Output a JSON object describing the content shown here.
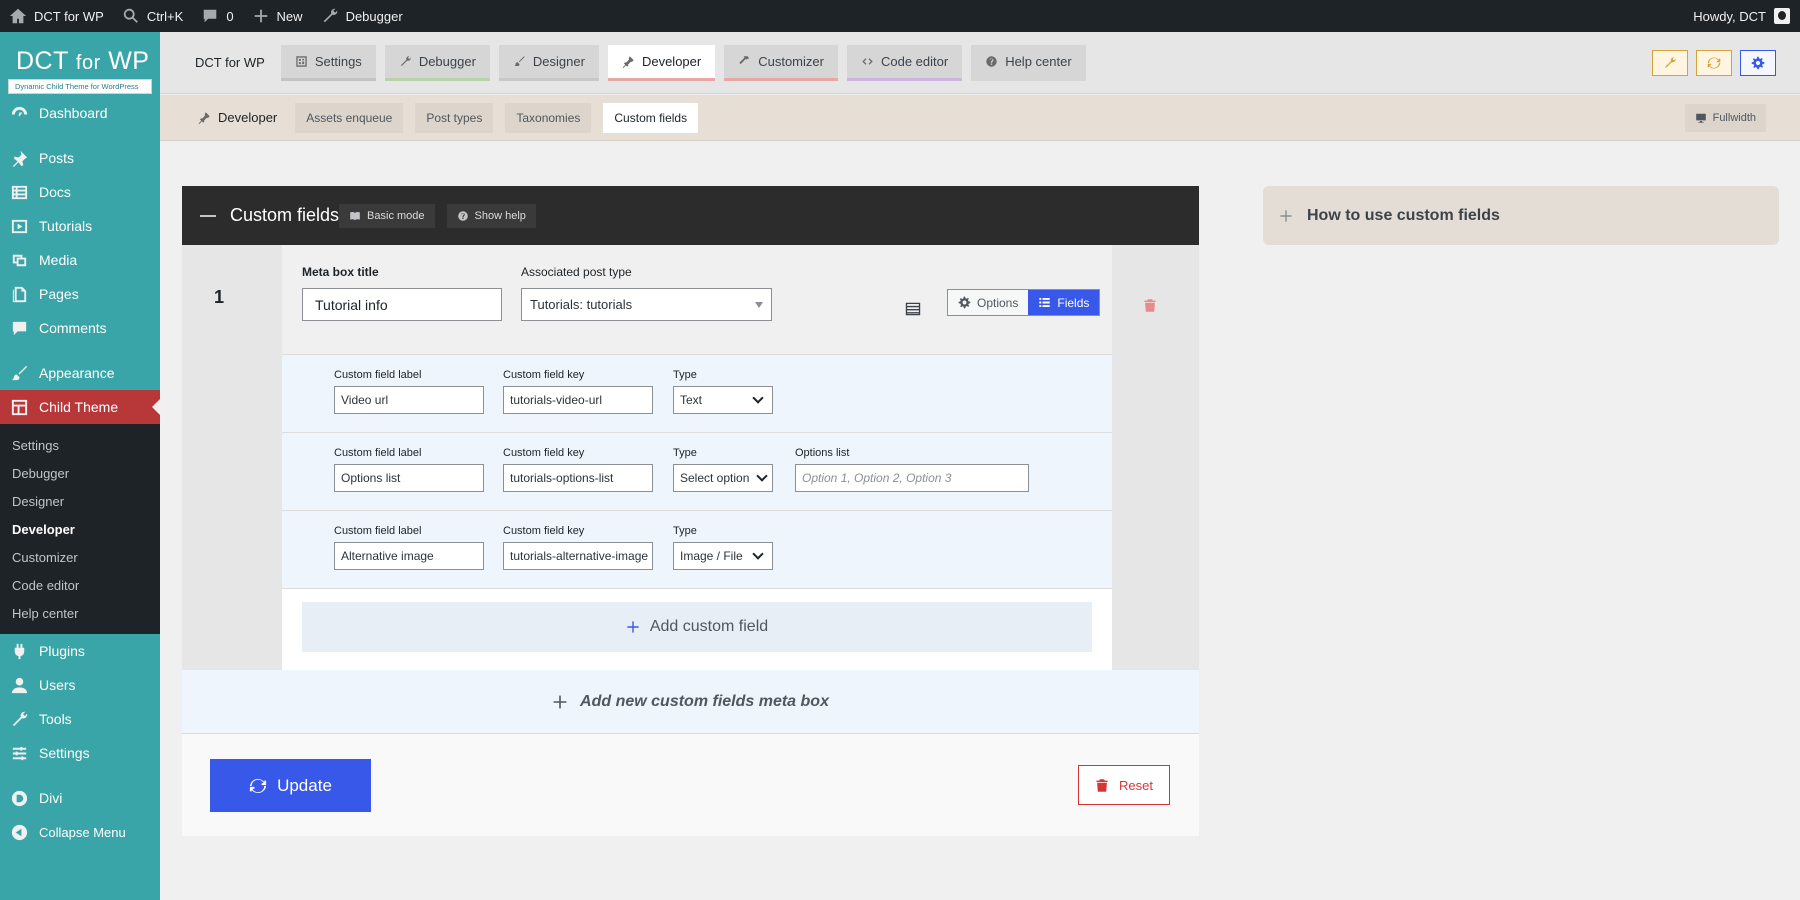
{
  "adminbar": {
    "site": "DCT for WP",
    "search": "Ctrl+K",
    "comments": "0",
    "new": "New",
    "debugger": "Debugger",
    "howdy": "Howdy, DCT"
  },
  "brand": {
    "logo_main": "DCT",
    "logo_small": "for",
    "logo_tail": "WP",
    "subtitle": "Dynamic Child Theme for WordPress"
  },
  "sidebar": {
    "items": [
      {
        "label": "Dashboard",
        "icon": "dashboard-icon"
      },
      {
        "label": "Posts",
        "icon": "pin-icon"
      },
      {
        "label": "Docs",
        "icon": "list-icon"
      },
      {
        "label": "Tutorials",
        "icon": "video-icon"
      },
      {
        "label": "Media",
        "icon": "media-icon"
      },
      {
        "label": "Pages",
        "icon": "pages-icon"
      },
      {
        "label": "Comments",
        "icon": "comment-icon"
      },
      {
        "label": "Appearance",
        "icon": "brush-icon"
      },
      {
        "label": "Child Theme",
        "icon": "grid-icon"
      },
      {
        "label": "Plugins",
        "icon": "plug-icon"
      },
      {
        "label": "Users",
        "icon": "user-icon"
      },
      {
        "label": "Tools",
        "icon": "wrench-icon"
      },
      {
        "label": "Settings",
        "icon": "settings-icon"
      },
      {
        "label": "Divi",
        "icon": "divi-icon"
      },
      {
        "label": "Collapse Menu",
        "icon": "collapse-icon"
      }
    ],
    "submenu": [
      "Settings",
      "Debugger",
      "Designer",
      "Developer",
      "Customizer",
      "Code editor",
      "Help center"
    ]
  },
  "topbar": {
    "title": "DCT for WP",
    "tabs": [
      "Settings",
      "Debugger",
      "Designer",
      "Developer",
      "Customizer",
      "Code editor",
      "Help center"
    ]
  },
  "subbar": {
    "title": "Developer",
    "tabs": [
      "Assets enqueue",
      "Post types",
      "Taxonomies",
      "Custom fields"
    ],
    "fullwidth": "Fullwidth"
  },
  "panel": {
    "title": "Custom fields",
    "basic_mode": "Basic mode",
    "show_help": "Show help",
    "metabox": {
      "number": "1",
      "title_label": "Meta box title",
      "title_value": "Tutorial info",
      "post_type_label": "Associated post type",
      "post_type_value": "Tutorials: tutorials",
      "options_btn": "Options",
      "fields_btn": "Fields",
      "fields": [
        {
          "label_caption": "Custom field label",
          "label": "Video url",
          "key_caption": "Custom field key",
          "key": "tutorials-video-url",
          "type_caption": "Type",
          "type": "Text"
        },
        {
          "label_caption": "Custom field label",
          "label": "Options list",
          "key_caption": "Custom field key",
          "key": "tutorials-options-list",
          "type_caption": "Type",
          "type": "Select option",
          "options_caption": "Options list",
          "options_placeholder": "Option 1, Option 2, Option 3"
        },
        {
          "label_caption": "Custom field label",
          "label": "Alternative image",
          "key_caption": "Custom field key",
          "key": "tutorials-alternative-image",
          "type_caption": "Type",
          "type": "Image / File"
        }
      ],
      "add_field": "Add custom field"
    },
    "add_metabox": "Add new custom fields meta box",
    "update": "Update",
    "reset": "Reset"
  },
  "help": {
    "title": "How to use custom fields"
  },
  "colors": {
    "sidebar": "#3aa5a8",
    "active_menu": "#b8383a",
    "accent": "#3858e9",
    "danger": "#d63638"
  }
}
